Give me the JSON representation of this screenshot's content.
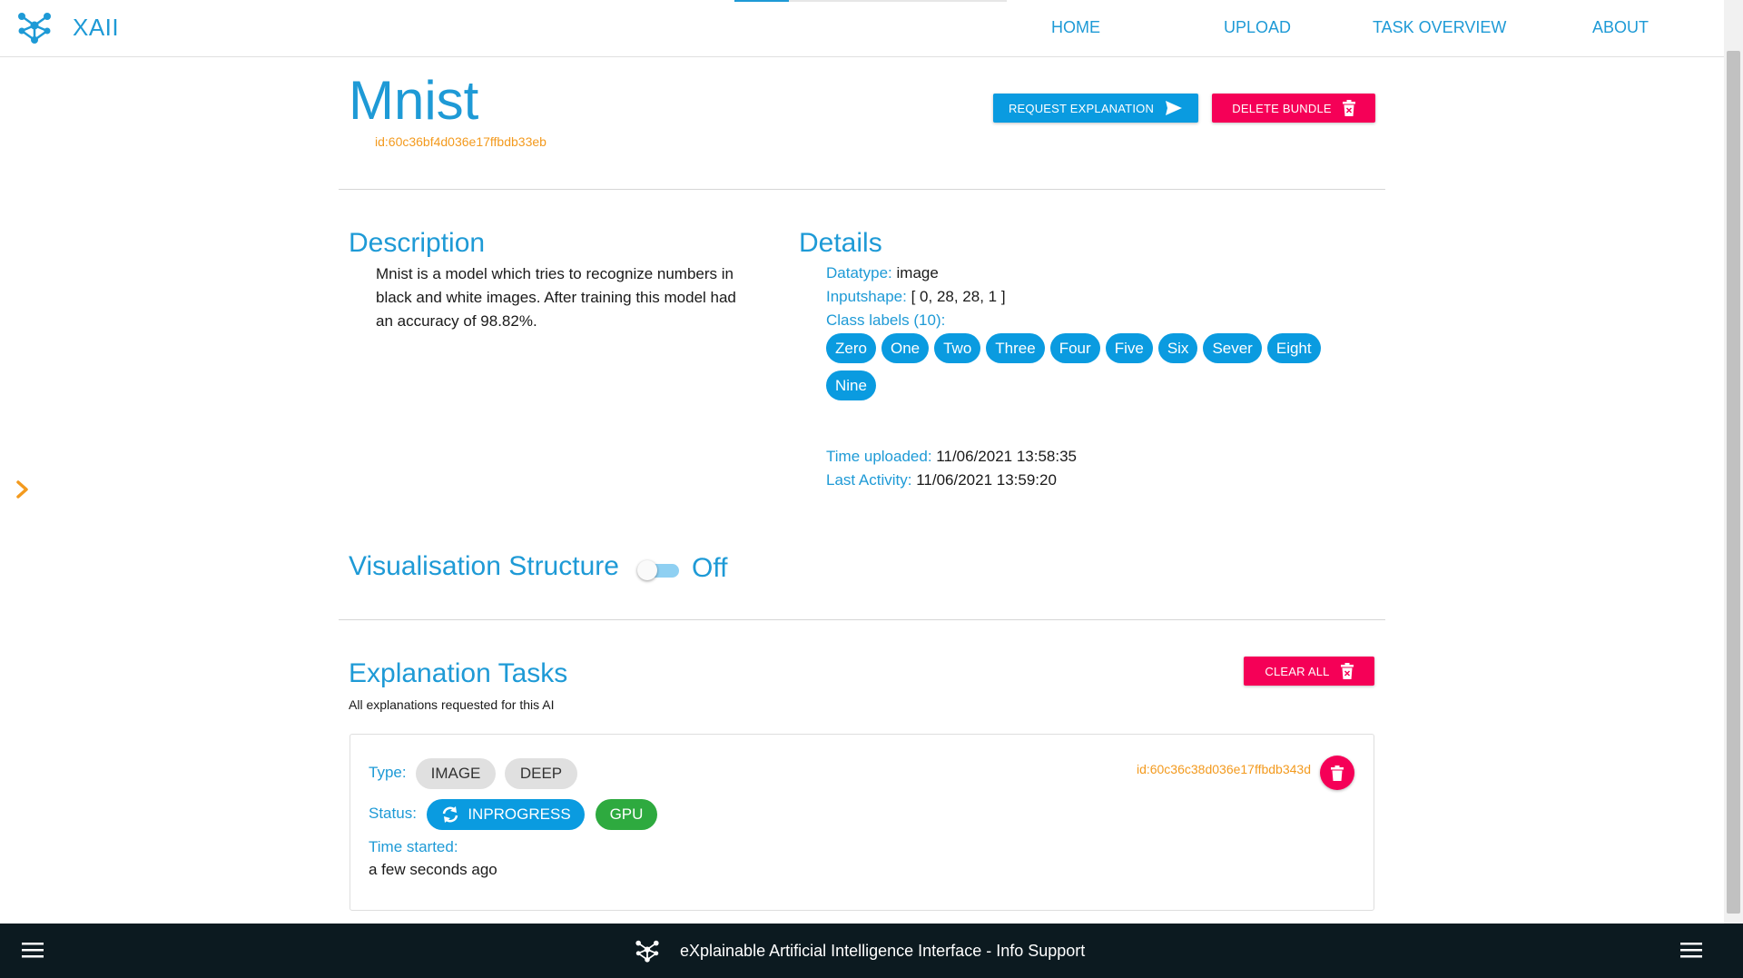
{
  "app": {
    "name": "XAII",
    "accent": "#1e9ad6",
    "danger": "#f50057",
    "highlight": "#f39a1e"
  },
  "nav": {
    "items": [
      "HOME",
      "UPLOAD",
      "TASK OVERVIEW",
      "ABOUT"
    ]
  },
  "bundle": {
    "title": "Mnist",
    "id": "id:60c36bf4d036e17ffbdb33eb",
    "request_label": "REQUEST EXPLANATION",
    "delete_label": "DELETE BUNDLE"
  },
  "description": {
    "heading": "Description",
    "text": "Mnist is a model which tries to recognize numbers in black and white images. After training this model had an accuracy of 98.82%."
  },
  "details": {
    "heading": "Details",
    "datatype_key": "Datatype:",
    "datatype_val": "image",
    "inputshape_key": "Inputshape:",
    "inputshape_val": "[ 0, 28, 28, 1 ]",
    "class_labels_key": "Class labels (10):",
    "class_labels": [
      "Zero",
      "One",
      "Two",
      "Three",
      "Four",
      "Five",
      "Six",
      "Sever",
      "Eight",
      "Nine"
    ],
    "uploaded_key": "Time uploaded:",
    "uploaded_val": "11/06/2021 13:58:35",
    "activity_key": "Last Activity:",
    "activity_val": "11/06/2021 13:59:20"
  },
  "visualisation": {
    "heading": "Visualisation Structure",
    "state": "Off",
    "enabled": false
  },
  "tasks": {
    "heading": "Explanation Tasks",
    "subtitle": "All explanations requested for this AI",
    "clear_label": "CLEAR ALL",
    "items": [
      {
        "type_key": "Type:",
        "types": [
          "IMAGE",
          "DEEP"
        ],
        "status_key": "Status:",
        "status": "INPROGRESS",
        "device": "GPU",
        "started_key": "Time started:",
        "started_val": "a few seconds ago",
        "id": "id:60c36c38d036e17ffbdb343d"
      }
    ]
  },
  "footer": {
    "text": "eXplainable Artificial Intelligence Interface - Info Support"
  },
  "icons": [
    "xaii-logo-icon",
    "send-icon",
    "trash-icon",
    "chevron-right-icon",
    "sync-icon",
    "menu-icon"
  ]
}
